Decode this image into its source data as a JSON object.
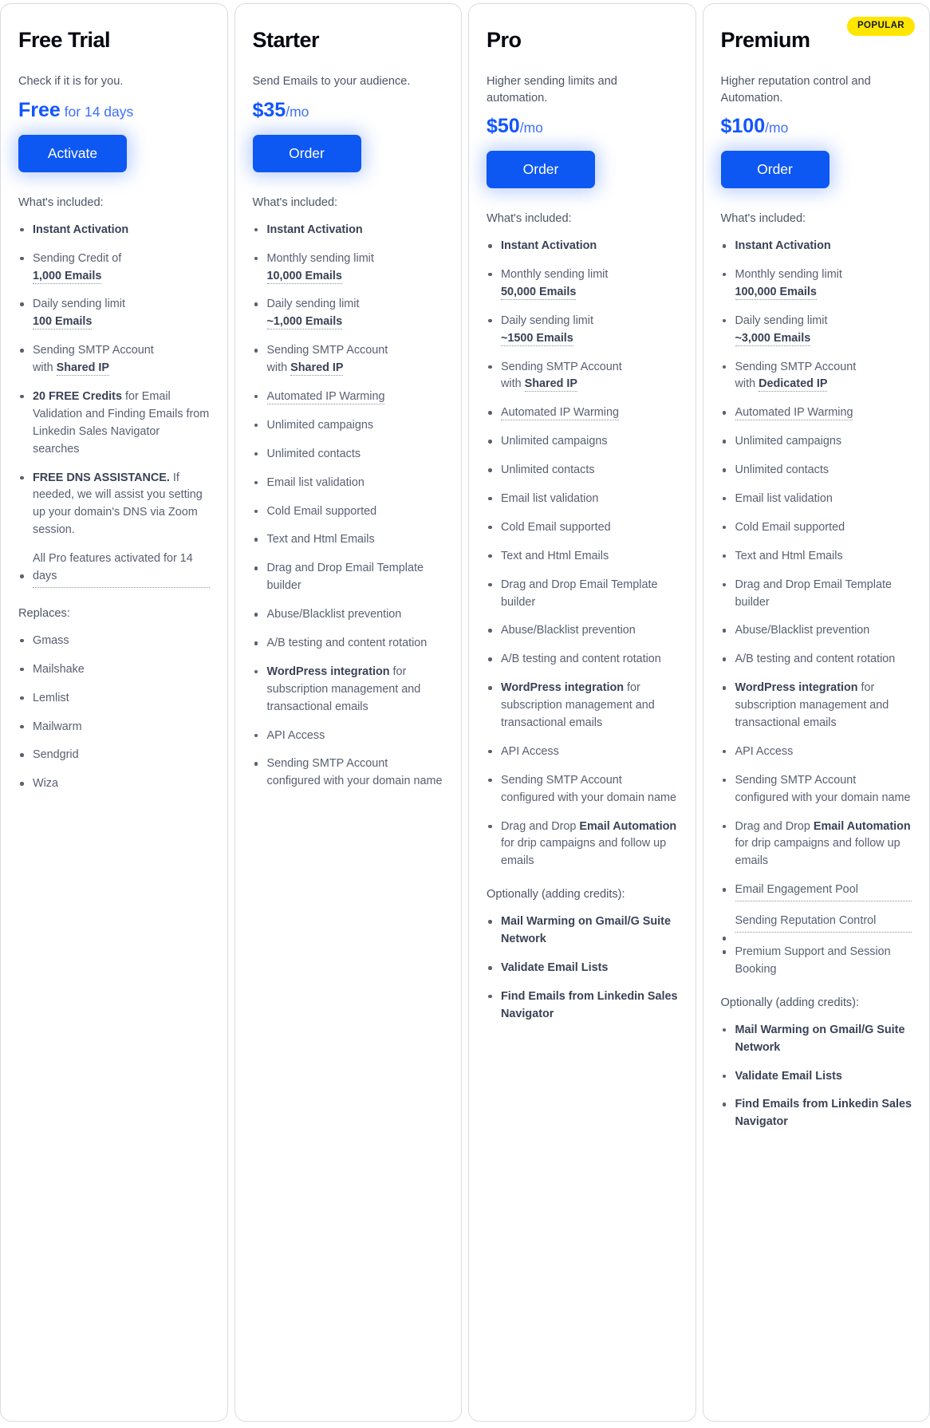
{
  "plans": [
    {
      "name": "Free Trial",
      "description": "Check if it is for you.",
      "price_amount": "Free",
      "price_suffix": " for 14 days",
      "cta_label": "Activate",
      "included_label": "What's included:",
      "badge": null,
      "features": [
        {
          "html": "<b>Instant Activation</b>"
        },
        {
          "html": "Sending Credit of<br><b class=\"dotted\">1,000 Emails</b>"
        },
        {
          "html": "Daily sending limit<br><b class=\"dotted\">100 Emails</b>"
        },
        {
          "html": "Sending SMTP Account<br>with <b class=\"dotted\">Shared IP</b>"
        },
        {
          "html": "<b>20 FREE Credits</b> for Email Validation and Finding Emails from Linkedin Sales Navigator searches"
        },
        {
          "html": "<b>FREE DNS ASSISTANCE.</b> If needed, we will assist you setting up your domain's DNS via Zoom session."
        },
        {
          "html": "<span class=\"dotted-block\">All Pro features activated for 14 days</span>",
          "bullet_low": true
        }
      ],
      "replaces_label": "Replaces:",
      "replaces": [
        "Gmass",
        "Mailshake",
        "Lemlist",
        "Mailwarm",
        "Sendgrid",
        "Wiza"
      ],
      "optional_label": null,
      "optional_features": []
    },
    {
      "name": "Starter",
      "description": "Send Emails to your audience.",
      "price_amount": "$35",
      "price_suffix": "/mo",
      "cta_label": "Order",
      "included_label": "What's included:",
      "badge": null,
      "features": [
        {
          "html": "<b>Instant Activation</b>"
        },
        {
          "html": "Monthly sending limit<br><b class=\"dotted\">10,000 Emails</b>"
        },
        {
          "html": "Daily sending limit<br><b class=\"dotted\">~1,000 Emails</b>"
        },
        {
          "html": "Sending SMTP Account<br>with <b class=\"dotted\">Shared IP</b>"
        },
        {
          "html": "<span class=\"dotted\">Automated IP Warming</span>"
        },
        {
          "html": "Unlimited campaigns"
        },
        {
          "html": "Unlimited contacts"
        },
        {
          "html": "Email list validation"
        },
        {
          "html": "Cold Email supported"
        },
        {
          "html": "Text and Html Emails"
        },
        {
          "html": "Drag and Drop Email Template builder"
        },
        {
          "html": "Abuse/Blacklist prevention"
        },
        {
          "html": "A/B testing and content rotation"
        },
        {
          "html": "<b>WordPress integration</b> for subscription management and transactional emails"
        },
        {
          "html": "API Access"
        },
        {
          "html": "Sending SMTP Account configured with your domain name"
        }
      ],
      "replaces_label": null,
      "replaces": [],
      "optional_label": null,
      "optional_features": []
    },
    {
      "name": "Pro",
      "description": "Higher sending limits and automation.",
      "price_amount": "$50",
      "price_suffix": "/mo",
      "cta_label": "Order",
      "included_label": "What's included:",
      "badge": null,
      "features": [
        {
          "html": "<b>Instant Activation</b>"
        },
        {
          "html": "Monthly sending limit<br><b class=\"dotted\">50,000 Emails</b>"
        },
        {
          "html": "Daily sending limit<br><b class=\"dotted\">~1500 Emails</b>"
        },
        {
          "html": "Sending SMTP Account<br>with <b class=\"dotted\">Shared IP</b>"
        },
        {
          "html": "<span class=\"dotted\">Automated IP Warming</span>"
        },
        {
          "html": "Unlimited campaigns"
        },
        {
          "html": "Unlimited contacts"
        },
        {
          "html": "Email list validation"
        },
        {
          "html": "Cold Email supported"
        },
        {
          "html": "Text and Html Emails"
        },
        {
          "html": "Drag and Drop Email Template builder"
        },
        {
          "html": "Abuse/Blacklist prevention"
        },
        {
          "html": "A/B testing and content rotation"
        },
        {
          "html": "<b>WordPress integration</b> for subscription management and transactional emails"
        },
        {
          "html": "API Access"
        },
        {
          "html": "Sending SMTP Account configured with your domain name"
        },
        {
          "html": "Drag and Drop <b>Email Automation</b> for drip campaigns and follow up emails"
        }
      ],
      "replaces_label": null,
      "replaces": [],
      "optional_label": "Optionally (adding credits):",
      "optional_features": [
        {
          "html": "<b>Mail Warming on Gmail/G Suite Network</b>"
        },
        {
          "html": "<b>Validate Email Lists</b>"
        },
        {
          "html": "<b>Find Emails from Linkedin Sales Navigator</b>"
        }
      ]
    },
    {
      "name": "Premium",
      "description": "Higher reputation control and Automation.",
      "price_amount": "$100",
      "price_suffix": "/mo",
      "cta_label": "Order",
      "included_label": "What's included:",
      "badge": "POPULAR",
      "features": [
        {
          "html": "<b>Instant Activation</b>"
        },
        {
          "html": "Monthly sending limit<br><b class=\"dotted\">100,000 Emails</b>"
        },
        {
          "html": "Daily sending limit<br><b class=\"dotted\">~3,000 Emails</b>"
        },
        {
          "html": "Sending SMTP Account<br>with <b class=\"dotted\">Dedicated IP</b>"
        },
        {
          "html": "<span class=\"dotted\">Automated IP Warming</span>"
        },
        {
          "html": "Unlimited campaigns"
        },
        {
          "html": "Unlimited contacts"
        },
        {
          "html": "Email list validation"
        },
        {
          "html": "Cold Email supported"
        },
        {
          "html": "Text and Html Emails"
        },
        {
          "html": "Drag and Drop Email Template builder"
        },
        {
          "html": "Abuse/Blacklist prevention"
        },
        {
          "html": "A/B testing and content rotation"
        },
        {
          "html": "<b>WordPress integration</b> for subscription management and transactional emails"
        },
        {
          "html": "API Access"
        },
        {
          "html": "Sending SMTP Account configured with your domain name"
        },
        {
          "html": "Drag and Drop <b>Email Automation</b> for drip campaigns and follow up emails"
        },
        {
          "html": "<span class=\"dotted-block\">Email Engagement Pool</span>"
        },
        {
          "html": "<span class=\"dotted-block\">Sending Reputation Control</span>",
          "bullet_low": true
        },
        {
          "html": "Premium Support and Session Booking"
        }
      ],
      "replaces_label": null,
      "replaces": [],
      "optional_label": "Optionally (adding credits):",
      "optional_features": [
        {
          "html": "<b>Mail Warming on Gmail/G Suite Network</b>"
        },
        {
          "html": "<b>Validate Email Lists</b>"
        },
        {
          "html": "<b>Find Emails from Linkedin Sales Navigator</b>"
        }
      ]
    }
  ],
  "colors": {
    "accent_blue": "#1155ff",
    "button_blue": "#0d57f2",
    "badge_yellow": "#ffe600",
    "text_dark": "#05060f",
    "text_body": "#586071",
    "border": "#d9dce3"
  }
}
